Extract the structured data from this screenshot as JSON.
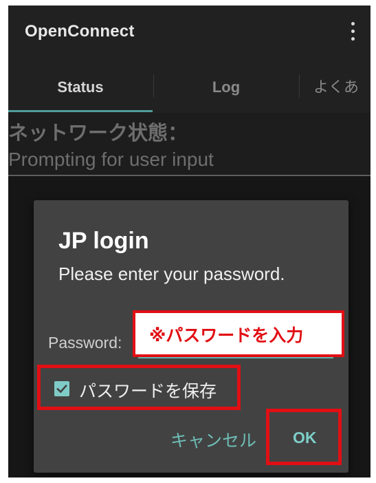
{
  "app": {
    "title": "OpenConnect"
  },
  "tabs": [
    {
      "label": "Status",
      "active": true
    },
    {
      "label": "Log",
      "active": false
    },
    {
      "label": "よくあ",
      "active": false
    }
  ],
  "status": {
    "heading": "ネットワーク状態：",
    "value": "Prompting for user input"
  },
  "dialog": {
    "title": "JP login",
    "message": "Please enter your password.",
    "password_label": "Password:",
    "password_value": "",
    "checkbox_label": "パスワードを保存",
    "checkbox_checked": true,
    "cancel_label": "キャンセル",
    "ok_label": "OK"
  },
  "annotations": {
    "password_callout": "※パスワードを入力"
  },
  "colors": {
    "accent": "#6fbcb6",
    "annotation_red": "#e10f14",
    "dialog_bg": "#424242",
    "appbar_bg": "#212121"
  },
  "icons": {
    "overflow_menu": "more-vert-icon",
    "checkbox": "checkbox-checked-icon"
  }
}
